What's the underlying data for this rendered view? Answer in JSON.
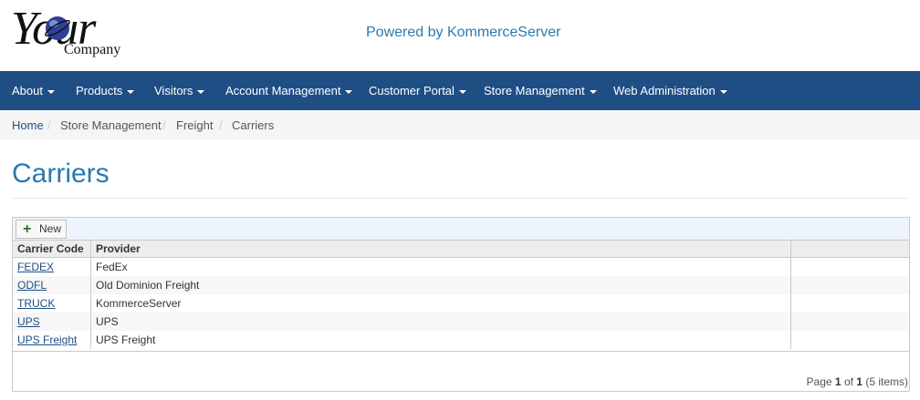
{
  "logo": {
    "word": "Your",
    "sub": "Company"
  },
  "powered_by": "Powered by KommerceServer",
  "nav": [
    {
      "label": "About"
    },
    {
      "label": "Products"
    },
    {
      "label": "Visitors"
    },
    {
      "label": "Account Management"
    },
    {
      "label": "Customer Portal"
    },
    {
      "label": "Store Management"
    },
    {
      "label": "Web Administration"
    }
  ],
  "breadcrumb": [
    "Home",
    "Store Management",
    "Freight",
    "Carriers"
  ],
  "breadcrumb_sep": "/",
  "page_title": "Carriers",
  "toolbar": {
    "new_label": "New"
  },
  "columns": [
    "Carrier Code",
    "Provider",
    ""
  ],
  "rows": [
    {
      "code": "FEDEX",
      "provider": "FedEx"
    },
    {
      "code": "ODFL",
      "provider": "Old Dominion Freight"
    },
    {
      "code": "TRUCK",
      "provider": "KommerceServer"
    },
    {
      "code": "UPS",
      "provider": "UPS"
    },
    {
      "code": "UPS Freight",
      "provider": "UPS Freight"
    }
  ],
  "pager": {
    "prefix": "Page",
    "current": "1",
    "of": "of",
    "total": "1",
    "items": "(5 items)"
  },
  "colors": {
    "nav_bg": "#1f4e85",
    "link": "#2a7ab0",
    "title": "#2a7ab0"
  }
}
